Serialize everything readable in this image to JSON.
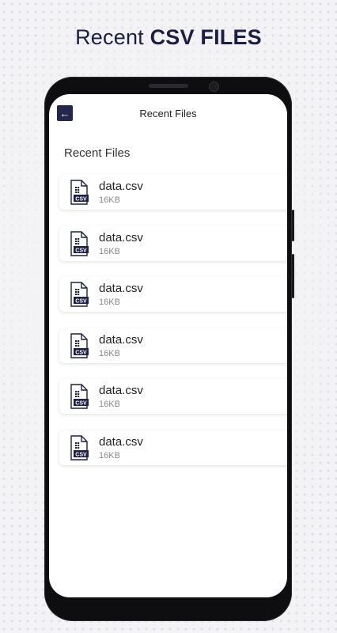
{
  "promo": {
    "title_regular": "Recent",
    "title_bold": "CSV FILES"
  },
  "app": {
    "toolbar_title": "Recent Files",
    "section_title": "Recent Files",
    "files": [
      {
        "name": "data.csv",
        "size": "16KB",
        "badge": "CSV"
      },
      {
        "name": "data.csv",
        "size": "16KB",
        "badge": "CSV"
      },
      {
        "name": "data.csv",
        "size": "16KB",
        "badge": "CSV"
      },
      {
        "name": "data.csv",
        "size": "16KB",
        "badge": "CSV"
      },
      {
        "name": "data.csv",
        "size": "16KB",
        "badge": "CSV"
      },
      {
        "name": "data.csv",
        "size": "16KB",
        "badge": "CSV"
      }
    ]
  },
  "icons": {
    "back": "arrow-left-icon",
    "file": "csv-file-icon",
    "menu": "more-vertical-icon"
  },
  "colors": {
    "accent": "#23274e",
    "headline": "#1c1f45",
    "background": "#f3f3f6"
  }
}
